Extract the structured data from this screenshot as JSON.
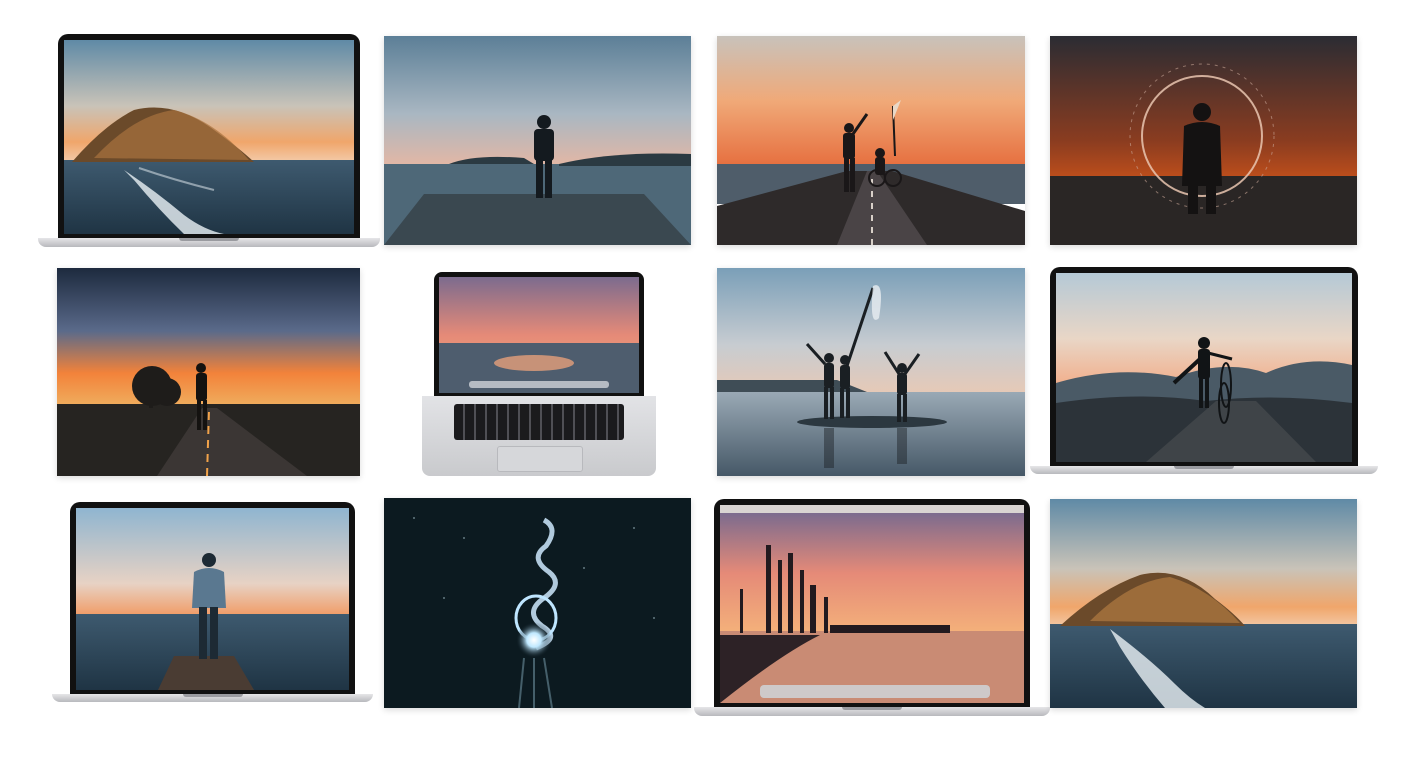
{
  "gallery": {
    "tiles": [
      {
        "id": 1,
        "subject": "island-wave",
        "frame": "laptop"
      },
      {
        "id": 2,
        "subject": "person-on-pier-dusk",
        "frame": "photo"
      },
      {
        "id": 3,
        "subject": "person-with-bike-on-jetty",
        "frame": "photo"
      },
      {
        "id": 4,
        "subject": "person-with-halo-ring",
        "frame": "photo"
      },
      {
        "id": 5,
        "subject": "person-on-road-sunset",
        "frame": "photo"
      },
      {
        "id": 6,
        "subject": "open-laptop-keyboard",
        "frame": "laptop-open"
      },
      {
        "id": 7,
        "subject": "three-people-celebrating",
        "frame": "photo"
      },
      {
        "id": 8,
        "subject": "person-with-bike-on-hill",
        "frame": "laptop"
      },
      {
        "id": 9,
        "subject": "person-on-dock-sunset",
        "frame": "laptop"
      },
      {
        "id": 10,
        "subject": "light-painting-night",
        "frame": "photo"
      },
      {
        "id": 11,
        "subject": "city-silhouette-sunset",
        "frame": "laptop"
      },
      {
        "id": 12,
        "subject": "island-wave",
        "frame": "photo"
      }
    ]
  }
}
